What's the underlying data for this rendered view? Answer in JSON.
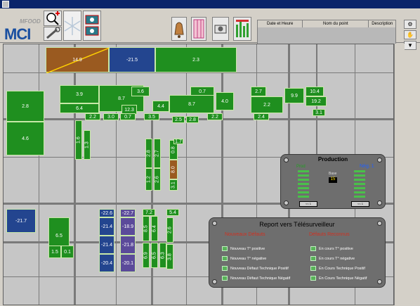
{
  "brand": {
    "small": "MFOOD",
    "big": "MCI"
  },
  "event_table": {
    "columns": [
      "Date et Heure",
      "Nom du point",
      "Description"
    ]
  },
  "map": {
    "zones": [
      {
        "label": "14.9",
        "color": "br"
      },
      {
        "label": "-21.5",
        "color": "b"
      },
      {
        "label": "2.3",
        "color": "g"
      },
      {
        "label": "3.9",
        "color": "g"
      },
      {
        "label": "6.4",
        "color": "g"
      },
      {
        "label": "8.7",
        "color": "g"
      },
      {
        "label": "3.6",
        "color": "g"
      },
      {
        "label": "12.3",
        "color": "g"
      },
      {
        "label": "4.4",
        "color": "g"
      },
      {
        "label": "2.2",
        "color": "g"
      },
      {
        "label": "3.0",
        "color": "g"
      },
      {
        "label": "0.7",
        "color": "g"
      },
      {
        "label": "3.5",
        "color": "g"
      },
      {
        "label": "0.7",
        "color": "g"
      },
      {
        "label": "8.7",
        "color": "g"
      },
      {
        "label": "4.0",
        "color": "g"
      },
      {
        "label": "2.5",
        "color": "g"
      },
      {
        "label": "2.8",
        "color": "g"
      },
      {
        "label": "2.2",
        "color": "g"
      },
      {
        "label": "2.7",
        "color": "g"
      },
      {
        "label": "9.9",
        "color": "g"
      },
      {
        "label": "10.4",
        "color": "g"
      },
      {
        "label": "19.2",
        "color": "g"
      },
      {
        "label": "2.2",
        "color": "g"
      },
      {
        "label": "2.4",
        "color": "g"
      },
      {
        "label": "3.1",
        "color": "g"
      },
      {
        "label": "2.8",
        "color": "g"
      },
      {
        "label": "4.6",
        "color": "g"
      },
      {
        "label": "1.6",
        "color": "g"
      },
      {
        "label": "1.3",
        "color": "g"
      },
      {
        "label": "2.8",
        "color": "g"
      },
      {
        "label": "2.7",
        "color": "g"
      },
      {
        "label": "1.2",
        "color": "g"
      },
      {
        "label": "2.6",
        "color": "g"
      },
      {
        "label": "0.8",
        "color": "g"
      },
      {
        "label": "1.7",
        "color": "g"
      },
      {
        "label": "8.0",
        "color": "g"
      },
      {
        "label": "3.1",
        "color": "g"
      },
      {
        "label": "-21.7",
        "color": "b"
      },
      {
        "label": "6.5",
        "color": "g"
      },
      {
        "label": "1.5",
        "color": "g"
      },
      {
        "label": "0.1",
        "color": "g"
      },
      {
        "label": "-22.6",
        "color": "b"
      },
      {
        "label": "-21.4",
        "color": "b"
      },
      {
        "label": "-21.4",
        "color": "b"
      },
      {
        "label": "-20.4",
        "color": "b"
      },
      {
        "label": "-22.7",
        "color": "p"
      },
      {
        "label": "-18.9",
        "color": "p"
      },
      {
        "label": "-21.8",
        "color": "p"
      },
      {
        "label": "-20.1",
        "color": "p"
      },
      {
        "label": "7.2",
        "color": "g"
      },
      {
        "label": "8.5",
        "color": "g"
      },
      {
        "label": "6.4",
        "color": "g"
      },
      {
        "label": "6.9",
        "color": "g"
      },
      {
        "label": "6.5",
        "color": "g"
      },
      {
        "label": "6.3",
        "color": "g"
      },
      {
        "label": "5.4",
        "color": "g"
      },
      {
        "label": "2.6",
        "color": "g"
      },
      {
        "label": "3.8",
        "color": "g"
      }
    ]
  },
  "production": {
    "title": "Production",
    "col_left": "Prod",
    "col_right": "Nég. 1",
    "center_label": "Base",
    "center_value": "15",
    "btn_left": "<< 1",
    "btn_right": "<< 1"
  },
  "report": {
    "title": "Report vers Télésurveilleur",
    "new_header": "Nouveaux Défauts",
    "ack_header": "Défauts Reconnus",
    "new_items": [
      "Nouveau T° positive",
      "Nouveau T° négative",
      "Nouveau Défaut Technique Positif",
      "Nouveau Défaut Technique Négatif"
    ],
    "ack_items": [
      "En cours T° positive",
      "En cours T° négative",
      "En Cours Technique Positif",
      "En Cours Technique Négatif"
    ]
  },
  "colors": {
    "green": "#1f8f1f",
    "blue": "#23458f",
    "purple": "#5b4a9a",
    "brown": "#9a5a20",
    "title_bar": "#0a246a"
  }
}
